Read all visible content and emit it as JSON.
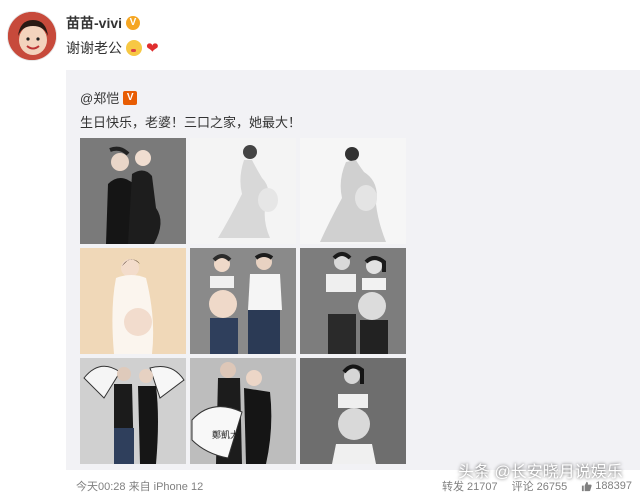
{
  "post": {
    "username": "苗苗-vivi",
    "verified_badge": "V",
    "text": "谢谢老公",
    "emoji_kiss": "kiss-face-icon",
    "emoji_heart": "❤"
  },
  "repost": {
    "author": "@郑恺",
    "verified_badge": "V",
    "text": "生日快乐，老婆！三口之家，她最大！",
    "fan_text": "鄭凱大"
  },
  "footer": {
    "time": "今天00:28 来自 iPhone 12",
    "repost_label": "转发 21707",
    "comment_label": "评论 26755",
    "like_count": "188397"
  },
  "watermark": "头条 @长安晓月说娱乐",
  "colors": {
    "accent_badge": "#f5a623",
    "heart": "#e02e2e",
    "repost_bg": "#f2f2f5"
  }
}
